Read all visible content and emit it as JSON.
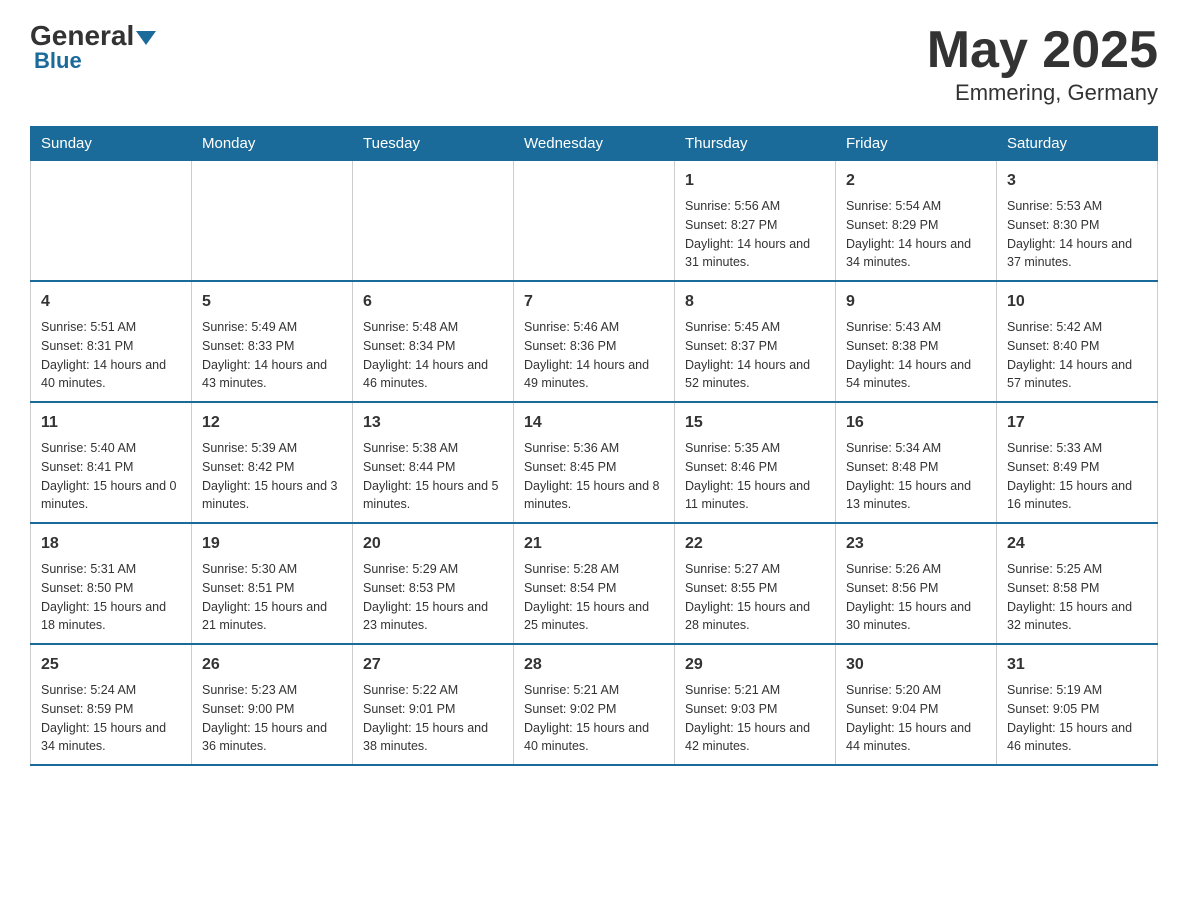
{
  "header": {
    "logo_general": "General",
    "logo_blue": "Blue",
    "month_year": "May 2025",
    "location": "Emmering, Germany"
  },
  "days_of_week": [
    "Sunday",
    "Monday",
    "Tuesday",
    "Wednesday",
    "Thursday",
    "Friday",
    "Saturday"
  ],
  "weeks": [
    {
      "days": [
        {
          "number": "",
          "info": ""
        },
        {
          "number": "",
          "info": ""
        },
        {
          "number": "",
          "info": ""
        },
        {
          "number": "",
          "info": ""
        },
        {
          "number": "1",
          "info": "Sunrise: 5:56 AM\nSunset: 8:27 PM\nDaylight: 14 hours and 31 minutes."
        },
        {
          "number": "2",
          "info": "Sunrise: 5:54 AM\nSunset: 8:29 PM\nDaylight: 14 hours and 34 minutes."
        },
        {
          "number": "3",
          "info": "Sunrise: 5:53 AM\nSunset: 8:30 PM\nDaylight: 14 hours and 37 minutes."
        }
      ]
    },
    {
      "days": [
        {
          "number": "4",
          "info": "Sunrise: 5:51 AM\nSunset: 8:31 PM\nDaylight: 14 hours and 40 minutes."
        },
        {
          "number": "5",
          "info": "Sunrise: 5:49 AM\nSunset: 8:33 PM\nDaylight: 14 hours and 43 minutes."
        },
        {
          "number": "6",
          "info": "Sunrise: 5:48 AM\nSunset: 8:34 PM\nDaylight: 14 hours and 46 minutes."
        },
        {
          "number": "7",
          "info": "Sunrise: 5:46 AM\nSunset: 8:36 PM\nDaylight: 14 hours and 49 minutes."
        },
        {
          "number": "8",
          "info": "Sunrise: 5:45 AM\nSunset: 8:37 PM\nDaylight: 14 hours and 52 minutes."
        },
        {
          "number": "9",
          "info": "Sunrise: 5:43 AM\nSunset: 8:38 PM\nDaylight: 14 hours and 54 minutes."
        },
        {
          "number": "10",
          "info": "Sunrise: 5:42 AM\nSunset: 8:40 PM\nDaylight: 14 hours and 57 minutes."
        }
      ]
    },
    {
      "days": [
        {
          "number": "11",
          "info": "Sunrise: 5:40 AM\nSunset: 8:41 PM\nDaylight: 15 hours and 0 minutes."
        },
        {
          "number": "12",
          "info": "Sunrise: 5:39 AM\nSunset: 8:42 PM\nDaylight: 15 hours and 3 minutes."
        },
        {
          "number": "13",
          "info": "Sunrise: 5:38 AM\nSunset: 8:44 PM\nDaylight: 15 hours and 5 minutes."
        },
        {
          "number": "14",
          "info": "Sunrise: 5:36 AM\nSunset: 8:45 PM\nDaylight: 15 hours and 8 minutes."
        },
        {
          "number": "15",
          "info": "Sunrise: 5:35 AM\nSunset: 8:46 PM\nDaylight: 15 hours and 11 minutes."
        },
        {
          "number": "16",
          "info": "Sunrise: 5:34 AM\nSunset: 8:48 PM\nDaylight: 15 hours and 13 minutes."
        },
        {
          "number": "17",
          "info": "Sunrise: 5:33 AM\nSunset: 8:49 PM\nDaylight: 15 hours and 16 minutes."
        }
      ]
    },
    {
      "days": [
        {
          "number": "18",
          "info": "Sunrise: 5:31 AM\nSunset: 8:50 PM\nDaylight: 15 hours and 18 minutes."
        },
        {
          "number": "19",
          "info": "Sunrise: 5:30 AM\nSunset: 8:51 PM\nDaylight: 15 hours and 21 minutes."
        },
        {
          "number": "20",
          "info": "Sunrise: 5:29 AM\nSunset: 8:53 PM\nDaylight: 15 hours and 23 minutes."
        },
        {
          "number": "21",
          "info": "Sunrise: 5:28 AM\nSunset: 8:54 PM\nDaylight: 15 hours and 25 minutes."
        },
        {
          "number": "22",
          "info": "Sunrise: 5:27 AM\nSunset: 8:55 PM\nDaylight: 15 hours and 28 minutes."
        },
        {
          "number": "23",
          "info": "Sunrise: 5:26 AM\nSunset: 8:56 PM\nDaylight: 15 hours and 30 minutes."
        },
        {
          "number": "24",
          "info": "Sunrise: 5:25 AM\nSunset: 8:58 PM\nDaylight: 15 hours and 32 minutes."
        }
      ]
    },
    {
      "days": [
        {
          "number": "25",
          "info": "Sunrise: 5:24 AM\nSunset: 8:59 PM\nDaylight: 15 hours and 34 minutes."
        },
        {
          "number": "26",
          "info": "Sunrise: 5:23 AM\nSunset: 9:00 PM\nDaylight: 15 hours and 36 minutes."
        },
        {
          "number": "27",
          "info": "Sunrise: 5:22 AM\nSunset: 9:01 PM\nDaylight: 15 hours and 38 minutes."
        },
        {
          "number": "28",
          "info": "Sunrise: 5:21 AM\nSunset: 9:02 PM\nDaylight: 15 hours and 40 minutes."
        },
        {
          "number": "29",
          "info": "Sunrise: 5:21 AM\nSunset: 9:03 PM\nDaylight: 15 hours and 42 minutes."
        },
        {
          "number": "30",
          "info": "Sunrise: 5:20 AM\nSunset: 9:04 PM\nDaylight: 15 hours and 44 minutes."
        },
        {
          "number": "31",
          "info": "Sunrise: 5:19 AM\nSunset: 9:05 PM\nDaylight: 15 hours and 46 minutes."
        }
      ]
    }
  ]
}
